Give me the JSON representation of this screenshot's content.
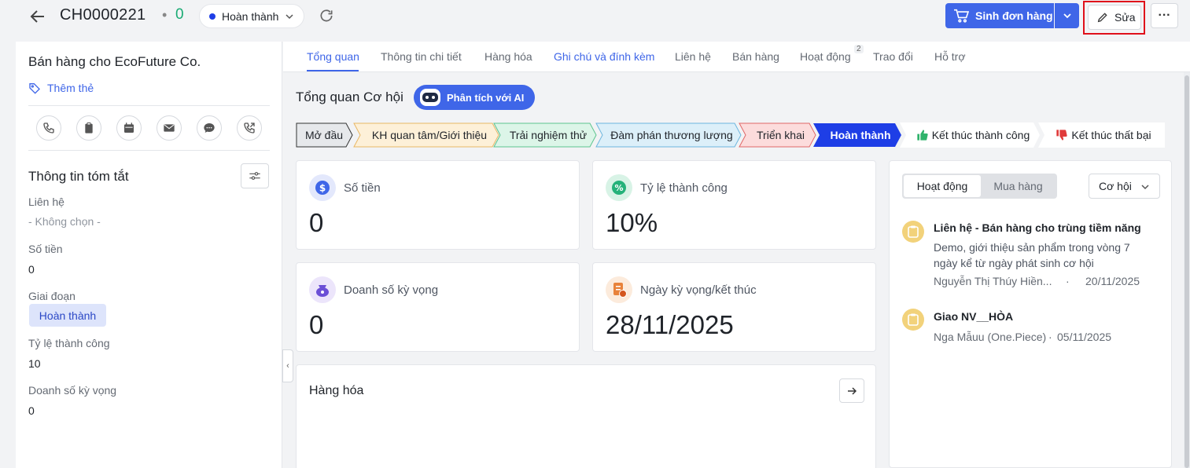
{
  "header": {
    "code": "CH0000221",
    "separator": "•",
    "amount": "0",
    "status": "Hoàn thành",
    "generate_order_label": "Sinh đơn hàng",
    "edit_label": "Sửa",
    "more_label": "···",
    "accent_color": "#3f66e8"
  },
  "left": {
    "title": "Bán hàng cho EcoFuture Co.",
    "add_tag": "Thêm thẻ",
    "actions": [
      "phone-icon",
      "clipboard-icon",
      "calendar-icon",
      "mail-icon",
      "chat-icon",
      "call-transfer-icon"
    ],
    "summary_title": "Thông tin tóm tắt",
    "fields": {
      "contact_label": "Liên hệ",
      "contact_value": "- Không chọn -",
      "amount_label": "Số tiền",
      "amount_value": "0",
      "stage_label": "Giai đoạn",
      "stage_value": "Hoàn thành",
      "rate_label": "Tỷ lệ thành công",
      "rate_value": "10",
      "expected_label": "Doanh số kỳ vọng",
      "expected_value": "0"
    }
  },
  "tabs": {
    "overview": "Tổng quan",
    "details": "Thông tin chi tiết",
    "goods": "Hàng hóa",
    "notes": "Ghi chú và đính kèm",
    "contacts": "Liên hệ",
    "sales": "Bán hàng",
    "activities": "Hoạt động",
    "activities_count": "2",
    "discussion": "Trao đổi",
    "support": "Hỗ trợ"
  },
  "overview": {
    "title": "Tổng quan Cơ hội",
    "ai_button": "Phân tích với AI"
  },
  "pipeline": {
    "s1": "Mở đầu",
    "s2": "KH quan tâm/Giới thiệu",
    "s3": "Trải nghiệm thử",
    "s4": "Đàm phán thương lượng",
    "s5": "Triển khai",
    "s6": "Hoàn thành",
    "s7": "Kết thúc thành công",
    "s8": "Kết thúc thất bại"
  },
  "cards": {
    "amount_label": "Số tiền",
    "amount_value": "0",
    "rate_label": "Tỷ lệ thành công",
    "rate_value": "10%",
    "expected_label": "Doanh số kỳ vọng",
    "expected_value": "0",
    "date_label": "Ngày kỳ vọng/kết thúc",
    "date_value": "28/11/2025",
    "goods_title": "Hàng hóa"
  },
  "right": {
    "seg_activity": "Hoạt động",
    "seg_purchase": "Mua hàng",
    "filter": "Cơ hội",
    "items": [
      {
        "title": "Liên hệ - Bán hàng cho trùng tiềm năng",
        "desc": "Demo, giới thiệu sản phẩm trong vòng 7 ngày kể từ ngày phát sinh cơ hội",
        "author": "Nguyễn Thị Thúy Hiền...",
        "sep": "·",
        "date": "20/11/2025"
      },
      {
        "title": "Giao NV__HÒA",
        "desc": "",
        "author": "Nga Mẫuu (One.Piece)",
        "sep": "·",
        "date": "05/11/2025"
      }
    ]
  }
}
